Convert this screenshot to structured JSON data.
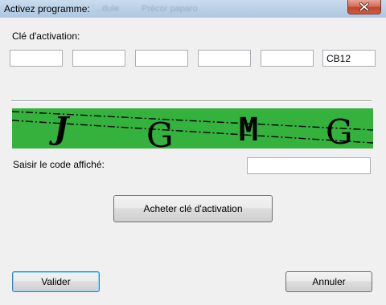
{
  "window": {
    "title": "Activez programme:",
    "background_titles": [
      "...dule",
      "Précor paparo"
    ]
  },
  "activation": {
    "label": "Clé d'activation:",
    "fields": [
      "",
      "",
      "",
      "",
      "",
      "CB12"
    ]
  },
  "captcha": {
    "characters": [
      "J",
      "G",
      "M",
      "G"
    ],
    "background_color": "#35b13d",
    "input_label": "Saisir le code affiché:",
    "input_value": ""
  },
  "buttons": {
    "buy": "Acheter clé d'activation",
    "ok": "Valider",
    "cancel": "Annuler"
  },
  "icons": {
    "close": "close-icon"
  }
}
